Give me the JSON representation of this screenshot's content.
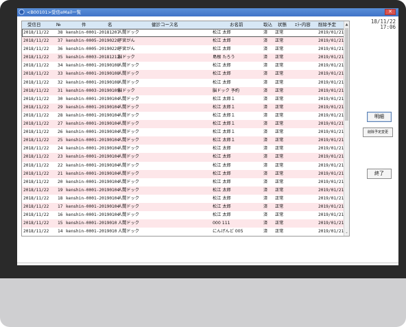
{
  "window": {
    "title": "<B00101>受信eMail一覧",
    "close_label": "✕"
  },
  "datetime": {
    "date": "18/11/22",
    "time": "17:06"
  },
  "buttons": {
    "detail": "明細",
    "change": "削除予定変更",
    "end": "終了"
  },
  "table": {
    "headers": [
      "受信日",
      "№",
      "件",
      "名",
      "健診コース名",
      "お名前",
      "取込",
      "状態",
      "ｴﾗｰ内容",
      "削除予定"
    ],
    "rows": [
      [
        "2018/11/22",
        "38",
        "kenshin-0001-20181207",
        "人間ドック",
        "松江 太郎",
        "済",
        "正常",
        "",
        "2019/01/21"
      ],
      [
        "2018/11/22",
        "37",
        "kenshin-0005-20190228",
        "子宮がん",
        "松江 太郎",
        "済",
        "正常",
        "",
        "2019/01/21"
      ],
      [
        "2018/11/22",
        "36",
        "kenshin-0005-20190228",
        "子宮がん",
        "松江 太郎",
        "済",
        "正常",
        "",
        "2019/01/21"
      ],
      [
        "2018/11/22",
        "35",
        "kenshin-0003-20181212",
        "脳ドック",
        "島根 たろう",
        "済",
        "正常",
        "",
        "2019/01/21"
      ],
      [
        "2018/11/22",
        "34",
        "kenshin-0001-20190108",
        "人間ドック",
        "松江 太郎",
        "済",
        "正常",
        "",
        "2019/01/21"
      ],
      [
        "2018/11/22",
        "33",
        "kenshin-0001-20190108",
        "人間ドック",
        "松江 太郎",
        "済",
        "正常",
        "",
        "2019/01/21"
      ],
      [
        "2018/11/22",
        "32",
        "kenshin-0001-20190108",
        "人間ドック",
        "松江 太郎",
        "済",
        "正常",
        "",
        "2019/01/21"
      ],
      [
        "2018/11/22",
        "31",
        "kenshin-0003-20190109",
        "脳ドック",
        "脳ドック 予約",
        "済",
        "正常",
        "",
        "2019/01/21"
      ],
      [
        "2018/11/22",
        "30",
        "kenshin-0001-20190104",
        "人間ドック",
        "松江 太郎１",
        "済",
        "正常",
        "",
        "2019/01/21"
      ],
      [
        "2018/11/22",
        "29",
        "kenshin-0001-20190104",
        "人間ドック",
        "松江 太郎１",
        "済",
        "正常",
        "",
        "2019/01/21"
      ],
      [
        "2018/11/22",
        "28",
        "kenshin-0001-20190104",
        "人間ドック",
        "松江 太郎１",
        "済",
        "正常",
        "",
        "2019/01/21"
      ],
      [
        "2018/11/22",
        "27",
        "kenshin-0001-20190104",
        "人間ドック",
        "松江 太郎１",
        "済",
        "正常",
        "",
        "2019/01/21"
      ],
      [
        "2018/11/22",
        "26",
        "kenshin-0001-20190104",
        "人間ドック",
        "松江 太郎１",
        "済",
        "正常",
        "",
        "2019/01/21"
      ],
      [
        "2018/11/22",
        "25",
        "kenshin-0001-20190104",
        "人間ドック",
        "松江 太郎１",
        "済",
        "正常",
        "",
        "2019/01/21"
      ],
      [
        "2018/11/22",
        "24",
        "kenshin-0001-20190104",
        "人間ドック",
        "松江 太郎",
        "済",
        "正常",
        "",
        "2019/01/21"
      ],
      [
        "2018/11/22",
        "23",
        "kenshin-0001-20190104",
        "人間ドック",
        "松江 太郎",
        "済",
        "正常",
        "",
        "2019/01/21"
      ],
      [
        "2018/11/22",
        "22",
        "kenshin-0001-20190104",
        "人間ドック",
        "松江 太郎",
        "済",
        "正常",
        "",
        "2019/01/21"
      ],
      [
        "2018/11/22",
        "21",
        "kenshin-0001-20190104",
        "人間ドック",
        "松江 太郎",
        "済",
        "正常",
        "",
        "2019/01/21"
      ],
      [
        "2018/11/22",
        "20",
        "kenshin-0001-20190104",
        "人間ドック",
        "松江 太郎",
        "済",
        "正常",
        "",
        "2019/01/21"
      ],
      [
        "2018/11/22",
        "19",
        "kenshin-0001-20190104",
        "人間ドック",
        "松江 太郎",
        "済",
        "正常",
        "",
        "2019/01/21"
      ],
      [
        "2018/11/22",
        "18",
        "kenshin-0001-20190104",
        "人間ドック",
        "松江 太郎",
        "済",
        "正常",
        "",
        "2019/01/21"
      ],
      [
        "2018/11/22",
        "17",
        "kenshin-0001-20190104",
        "人間ドック",
        "松江 太郎",
        "済",
        "正常",
        "",
        "2019/01/21"
      ],
      [
        "2018/11/22",
        "16",
        "kenshin-0001-20190104",
        "人間ドック",
        "松江 太郎",
        "済",
        "正常",
        "",
        "2019/01/21"
      ],
      [
        "2018/11/22",
        "15",
        "kenshin-0001-2019010",
        "人間ドック",
        "000 111",
        "済",
        "正常",
        "",
        "2019/01/21"
      ],
      [
        "2018/11/22",
        "14",
        "kenshin-0001-2019010",
        "人間ドック",
        "にんげんど 005",
        "済",
        "正常",
        "",
        "2019/01/21"
      ]
    ]
  },
  "icons": {
    "app": "app-icon",
    "scroll_up": "▲",
    "scroll_down": "⌄"
  },
  "colors": {
    "header_bg": "#d7e7f5",
    "stripe": "#fde6e9",
    "title_bar": "#3f73c8"
  }
}
